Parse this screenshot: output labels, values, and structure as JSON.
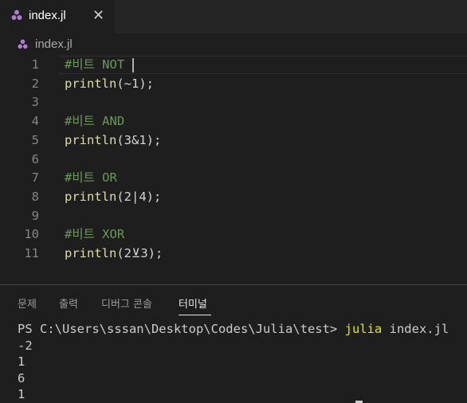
{
  "tab": {
    "label": "index.jl",
    "close_glyph": "✕",
    "icon": "julia-dots-icon"
  },
  "breadcrumb": {
    "label": "index.jl",
    "icon": "julia-dots-icon"
  },
  "editor": {
    "lines": [
      {
        "num": "1",
        "text": "#비트 NOT",
        "kind": "comment"
      },
      {
        "num": "2",
        "fn": "println",
        "args": "(~1);"
      },
      {
        "num": "3"
      },
      {
        "num": "4",
        "text": "#비트 AND",
        "kind": "comment"
      },
      {
        "num": "5",
        "fn": "println",
        "args": "(3&1);"
      },
      {
        "num": "6"
      },
      {
        "num": "7",
        "text": "#비트 OR",
        "kind": "comment"
      },
      {
        "num": "8",
        "fn": "println",
        "args": "(2|4);"
      },
      {
        "num": "9"
      },
      {
        "num": "10",
        "text": "#비트 XOR",
        "kind": "comment"
      },
      {
        "num": "11",
        "fn": "println",
        "args": "(2⊻3);"
      }
    ]
  },
  "panel": {
    "tabs": [
      "문제",
      "출력",
      "디버그 콘솔",
      "터미널"
    ],
    "active_tab": "터미널"
  },
  "terminal": {
    "prompt": "PS C:\\Users\\sssan\\Desktop\\Codes\\Julia\\test> ",
    "command": "julia",
    "command_args": " index.jl",
    "output": [
      "-2",
      "1",
      "6",
      "1"
    ]
  },
  "colors": {
    "julia_purple": "#9558b2",
    "comment": "#6a9955",
    "function": "#dcdcaa",
    "terminal_command": "#e5e510"
  }
}
